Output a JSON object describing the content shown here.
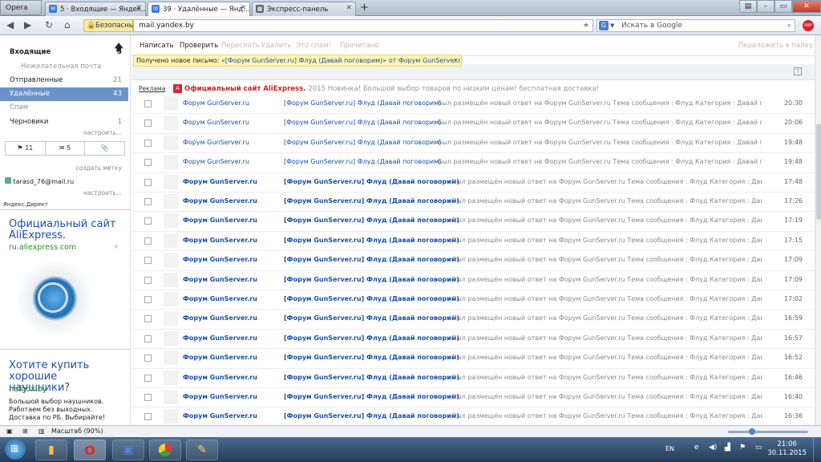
{
  "browser": {
    "menu_label": "Opera",
    "tabs": [
      {
        "label": "5 · Входящие — Яндек..."
      },
      {
        "label": "39 · Удалённые — Янд..."
      },
      {
        "label": "Экспресс-панель"
      }
    ],
    "security_label": "Безопасный",
    "url": "mail.yandex.by",
    "search_placeholder": "Искать в Google",
    "search_engine": "G",
    "abp_label": "ABP"
  },
  "sidebar": {
    "folders": [
      {
        "label": "Входящие",
        "count": "5"
      },
      {
        "label": "Нежелательная почта",
        "count": ""
      },
      {
        "label": "Отправленные",
        "count": "21"
      },
      {
        "label": "Удалённые",
        "count": "43"
      },
      {
        "label": "Спам",
        "count": ""
      },
      {
        "label": "Черновики",
        "count": "1"
      }
    ],
    "configure_link": "настроить...",
    "flag_count": "11",
    "mail_count": "5",
    "create_label_link": "создать метку",
    "account_email": "tarasd_76@mail.ru",
    "account_configure": "настроить...",
    "direct_label": "Яндекс.Директ",
    "ads": [
      {
        "title": "Официальный сайт AliExpress.",
        "url": "ru.aliexpress.com"
      },
      {
        "title": "Хотите купить хорошие наушники?",
        "url": "netbox.by",
        "text": "Большой выбор наушников. Работаем без выходных. Доставка по РБ. Выбирайте!"
      }
    ]
  },
  "toolbar": {
    "compose": "Написать",
    "check": "Проверить",
    "forward": "Переслать",
    "delete": "Удалить",
    "spam": "Это спам!",
    "read": "Прочитано",
    "move": "Переложить в папку"
  },
  "notice": {
    "prefix": "Получено новое письмо:",
    "subject": "«[Форум GunServer.ru] Флуд (Давай поговорим)» от Форум GunServer.ru."
  },
  "ad_row": {
    "label": "Реклама",
    "title": "Официальный сайт AliExpress.",
    "text": "2015 Новинка! Большой выбор товаров по низким ценам! бесплатная доставка!"
  },
  "messages": [
    {
      "from": "Форум GunServer.ru",
      "subject": "[Форум GunServer.ru] Флуд (Давай поговорим)",
      "snippet": "Был размещён новый ответ на Форум GunServer.ru Тема сообщения : Флуд Категория : Давай поговорим",
      "time": "20:30",
      "unread": false
    },
    {
      "from": "Форум GunServer.ru",
      "subject": "[Форум GunServer.ru] Флуд (Давай поговорим)",
      "snippet": "Был размещён новый ответ на Форум GunServer.ru Тема сообщения : Флуд Категория : Давай поговорим",
      "time": "20:06",
      "unread": false
    },
    {
      "from": "Форум GunServer.ru",
      "subject": "[Форум GunServer.ru] Флуд (Давай поговорим)",
      "snippet": "Был размещён новый ответ на Форум GunServer.ru Тема сообщения : Флуд Категория : Давай поговорим",
      "time": "19:48",
      "unread": false
    },
    {
      "from": "Форум GunServer.ru",
      "subject": "[Форум GunServer.ru] Флуд (Давай поговорим)",
      "snippet": "Был размещён новый ответ на Форум GunServer.ru Тема сообщения : Флуд Категория : Давай поговорим",
      "time": "19:48",
      "unread": false
    },
    {
      "from": "Форум GunServer.ru",
      "subject": "[Форум GunServer.ru] Флуд (Давай поговорим)",
      "snippet": "Был размещён новый ответ на Форум GunServer.ru Тема сообщения : Флуд Категория : Давай поговорим",
      "time": "17:48",
      "unread": true
    },
    {
      "from": "Форум GunServer.ru",
      "subject": "[Форум GunServer.ru] Флуд (Давай поговорим)",
      "snippet": "Был размещён новый ответ на Форум GunServer.ru Тема сообщения : Флуд Категория : Давай поговорим",
      "time": "17:26",
      "unread": true
    },
    {
      "from": "Форум GunServer.ru",
      "subject": "[Форум GunServer.ru] Флуд (Давай поговорим)",
      "snippet": "Был размещён новый ответ на Форум GunServer.ru Тема сообщения : Флуд Категория : Давай поговорим",
      "time": "17:19",
      "unread": true
    },
    {
      "from": "Форум GunServer.ru",
      "subject": "[Форум GunServer.ru] Флуд (Давай поговорим)",
      "snippet": "Был размещён новый ответ на Форум GunServer.ru Тема сообщения : Флуд Категория : Давай поговорим",
      "time": "17:15",
      "unread": true
    },
    {
      "from": "Форум GunServer.ru",
      "subject": "[Форум GunServer.ru] Флуд (Давай поговорим)",
      "snippet": "Был размещён новый ответ на Форум GunServer.ru Тема сообщения : Флуд Категория : Давай поговорим",
      "time": "17:09",
      "unread": true
    },
    {
      "from": "Форум GunServer.ru",
      "subject": "[Форум GunServer.ru] Флуд (Давай поговорим)",
      "snippet": "Был размещён новый ответ на Форум GunServer.ru Тема сообщения : Флуд Категория : Давай поговорим",
      "time": "17:09",
      "unread": true
    },
    {
      "from": "Форум GunServer.ru",
      "subject": "[Форум GunServer.ru] Флуд (Давай поговорим)",
      "snippet": "Был размещён новый ответ на Форум GunServer.ru Тема сообщения : Флуд Категория : Давай поговорим",
      "time": "17:02",
      "unread": true
    },
    {
      "from": "Форум GunServer.ru",
      "subject": "[Форум GunServer.ru] Флуд (Давай поговорим)",
      "snippet": "Был размещён новый ответ на Форум GunServer.ru Тема сообщения : Флуд Категория : Давай поговорим",
      "time": "16:59",
      "unread": true
    },
    {
      "from": "Форум GunServer.ru",
      "subject": "[Форум GunServer.ru] Флуд (Давай поговорим)",
      "snippet": "Был размещён новый ответ на Форум GunServer.ru Тема сообщения : Флуд Категория : Давай поговорим",
      "time": "16:57",
      "unread": true
    },
    {
      "from": "Форум GunServer.ru",
      "subject": "[Форум GunServer.ru] Флуд (Давай поговорим)",
      "snippet": "Был размещён новый ответ на Форум GunServer.ru Тема сообщения : Флуд Категория : Давай поговорим",
      "time": "16:52",
      "unread": true
    },
    {
      "from": "Форум GunServer.ru",
      "subject": "[Форум GunServer.ru] Флуд (Давай поговорим)",
      "snippet": "Был размещён новый ответ на Форум GunServer.ru Тема сообщения : Флуд Категория : Давай поговорим",
      "time": "16:46",
      "unread": true
    },
    {
      "from": "Форум GunServer.ru",
      "subject": "[Форум GunServer.ru] Флуд (Давай поговорим)",
      "snippet": "Был размещён новый ответ на Форум GunServer.ru Тема сообщения : Флуд Категория : Давай поговорим",
      "time": "16:40",
      "unread": true
    },
    {
      "from": "Форум GunServer.ru",
      "subject": "[Форум GunServer.ru] Флуд (Давай поговорим)",
      "snippet": "Был размещён новый ответ на Форум GunServer.ru Тема сообщения : Флуд Категория : Давай поговорим",
      "time": "16:36",
      "unread": true
    }
  ],
  "status": {
    "zoom": "Масштаб (90%)"
  },
  "taskbar": {
    "lang": "EN",
    "time": "21:06",
    "date": "30.11.2015"
  }
}
